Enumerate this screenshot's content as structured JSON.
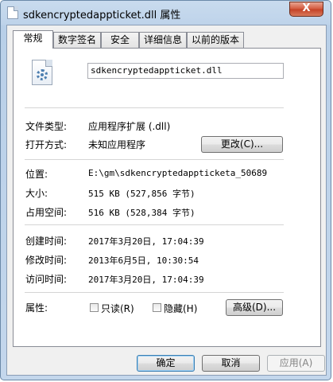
{
  "window": {
    "title": "sdkencryptedappticket.dll 属性",
    "close_label": "X"
  },
  "tabs": [
    {
      "label": "常规",
      "active": true
    },
    {
      "label": "数字签名",
      "active": false
    },
    {
      "label": "安全",
      "active": false
    },
    {
      "label": "详细信息",
      "active": false
    },
    {
      "label": "以前的版本",
      "active": false
    }
  ],
  "general": {
    "file_name": "sdkencryptedappticket.dll",
    "file_icon": "dll-gear-icon",
    "file_type_label": "文件类型:",
    "file_type_value": "应用程序扩展 (.dll)",
    "open_with_label": "打开方式:",
    "open_with_value": "未知应用程序",
    "change_button": "更改(C)...",
    "location_label": "位置:",
    "location_value": "E:\\gm\\sdkencryptedappticketa_50689",
    "size_label": "大小:",
    "size_value": "515 KB (527,856 字节)",
    "size_on_disk_label": "占用空间:",
    "size_on_disk_value": "516 KB (528,384 字节)",
    "created_label": "创建时间:",
    "created_value": "2017年3月20日, 17:04:39",
    "modified_label": "修改时间:",
    "modified_value": "2013年6月5日, 10:30:54",
    "accessed_label": "访问时间:",
    "accessed_value": "2017年3月20日, 17:04:39",
    "attributes_label": "属性:",
    "readonly_label": "只读(R)",
    "readonly_checked": false,
    "hidden_label": "隐藏(H)",
    "hidden_checked": false,
    "advanced_button": "高级(D)..."
  },
  "footer": {
    "ok_button": "确定",
    "cancel_button": "取消",
    "apply_button": "应用(A)"
  },
  "colors": {
    "frame": "#bed3ea",
    "close_button": "#c44025",
    "default_button_border": "#3c7fb1"
  }
}
